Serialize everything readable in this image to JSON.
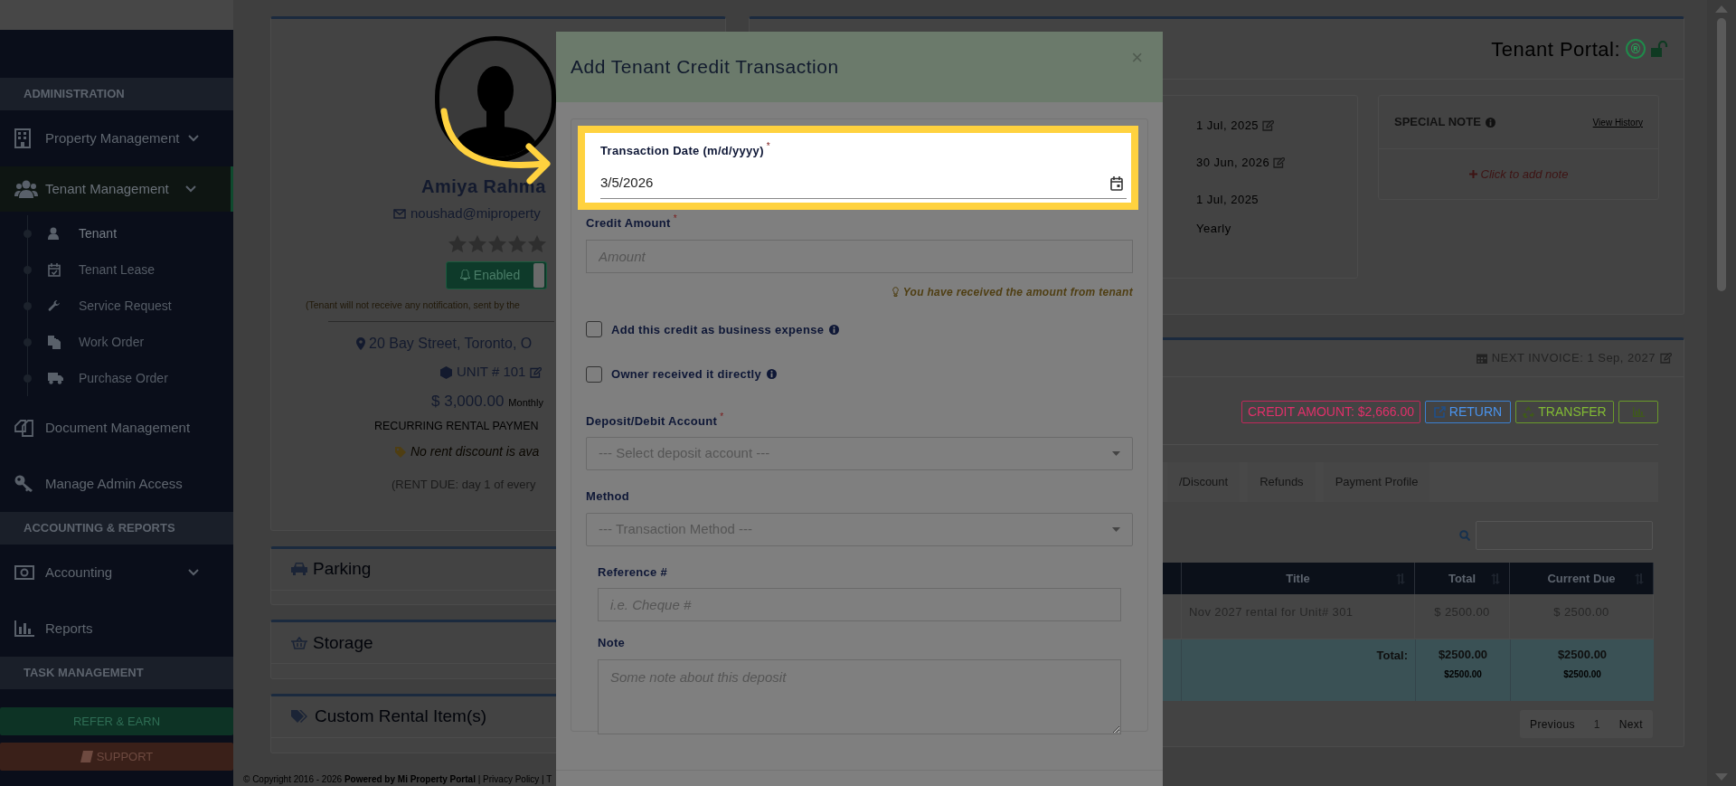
{
  "sidebar": {
    "sections": [
      {
        "title": "ADMINISTRATION",
        "items": [
          {
            "label": "Property Management",
            "expandable": true,
            "selected": false
          },
          {
            "label": "Tenant Management",
            "expandable": true,
            "selected": true,
            "children": [
              {
                "label": "Tenant",
                "selected": true
              },
              {
                "label": "Tenant Lease",
                "selected": false
              },
              {
                "label": "Service Request",
                "selected": false
              },
              {
                "label": "Work Order",
                "selected": false
              },
              {
                "label": "Purchase Order",
                "selected": false
              }
            ]
          },
          {
            "label": "Document Management",
            "expandable": false,
            "selected": false
          },
          {
            "label": "Manage Admin Access",
            "expandable": false,
            "selected": false
          }
        ]
      },
      {
        "title": "ACCOUNTING & REPORTS",
        "items": [
          {
            "label": "Accounting",
            "expandable": true,
            "selected": false
          },
          {
            "label": "Reports",
            "expandable": false,
            "selected": false
          }
        ]
      },
      {
        "title": "TASK MANAGEMENT"
      }
    ],
    "buttons": [
      {
        "label": "REFER & EARN",
        "kind": "refer"
      },
      {
        "label": "SUPPORT",
        "kind": "support"
      }
    ]
  },
  "tenant_card": {
    "name": "Amiya Rahma",
    "email": "noushad@miproperty",
    "stars": 0,
    "notification": {
      "label": "Enabled",
      "on": true
    },
    "notice": "(Tenant will not receive any notification, sent by the",
    "address": "20 Bay Street, Toronto, O",
    "unit": "UNIT # 101",
    "rent": "$ 3,000.00",
    "rent_period": "Monthly",
    "recurring": "RECURRING RENTAL PAYMEN",
    "discount": "No rent discount is ava",
    "rent_due": "(RENT DUE: day 1 of every"
  },
  "side_panels": [
    {
      "title": "Parking"
    },
    {
      "title": "Storage"
    },
    {
      "title": "Custom Rental Item(s)"
    }
  ],
  "footer": "© Copyright 2016 - 2026 **Powered by Mi Property Portal** | Privacy Policy | T",
  "lease_card": {
    "portal_label": "Tenant Portal:",
    "portal_mark": "®",
    "dates": [
      {
        "value": "1 Jul, 2025",
        "editable": true
      },
      {
        "value": "30 Jun, 2026",
        "editable": true
      },
      {
        "value": "1 Jul, 2025",
        "editable": false
      },
      {
        "value": "Yearly",
        "editable": false
      }
    ],
    "special_note": {
      "title": "SPECIAL NOTE",
      "link": "View History",
      "add": "Click to add note"
    }
  },
  "invoice_card": {
    "next_invoice": "NEXT INVOICE: 1 Sep, 2027",
    "actions": [
      {
        "kind": "credit",
        "label": "CREDIT AMOUNT: $2,666.00"
      },
      {
        "kind": "return",
        "label": "RETURN"
      },
      {
        "kind": "transfer",
        "label": "TRANSFER"
      },
      {
        "kind": "chart"
      }
    ],
    "tabs": [
      {
        "label": "/Discount",
        "selected": false
      },
      {
        "label": "Refunds",
        "selected": false
      },
      {
        "label": "Payment Profile",
        "selected": false
      }
    ],
    "table": {
      "columns": [
        "Title",
        "Total",
        "Current Due"
      ],
      "rows": [
        [
          "Nov 2027 rental for Unit# 301",
          "$ 2500.00",
          "$ 2500.00"
        ]
      ],
      "totals": {
        "label": "Total:",
        "values": [
          {
            "main": "$2500.00",
            "sub": "$2500.00"
          },
          {
            "main": "$2500.00",
            "sub": "$2500.00"
          }
        ]
      }
    },
    "pagination": [
      "Previous",
      "1",
      "Next"
    ]
  },
  "modal": {
    "title": "Add Tenant Credit Transaction",
    "close": "×",
    "fields": [
      {
        "kind": "date",
        "label": "Transaction Date (m/d/yyyy)",
        "required_mark": "*",
        "value": "3/5/2026",
        "highlighted": true
      },
      {
        "kind": "text",
        "label": "Credit Amount",
        "required_mark": "*",
        "placeholder": "Amount",
        "hint": "You have received the amount from tenant"
      },
      {
        "kind": "checkbox",
        "label": "Add this credit as business expense",
        "checked": false,
        "info": true
      },
      {
        "kind": "checkbox",
        "label": "Owner received it directly",
        "checked": false,
        "info": true
      },
      {
        "kind": "select",
        "label": "Deposit/Debit Account",
        "required_mark": "*",
        "placeholder": "--- Select deposit account ---"
      },
      {
        "kind": "select",
        "label": "Method",
        "placeholder": "--- Transaction Method ---"
      },
      {
        "kind": "text",
        "label": "Reference #",
        "placeholder": "i.e. Cheque #",
        "indented": true
      },
      {
        "kind": "textarea",
        "label": "Note",
        "placeholder": "Some note about this deposit",
        "indented": true
      }
    ]
  }
}
